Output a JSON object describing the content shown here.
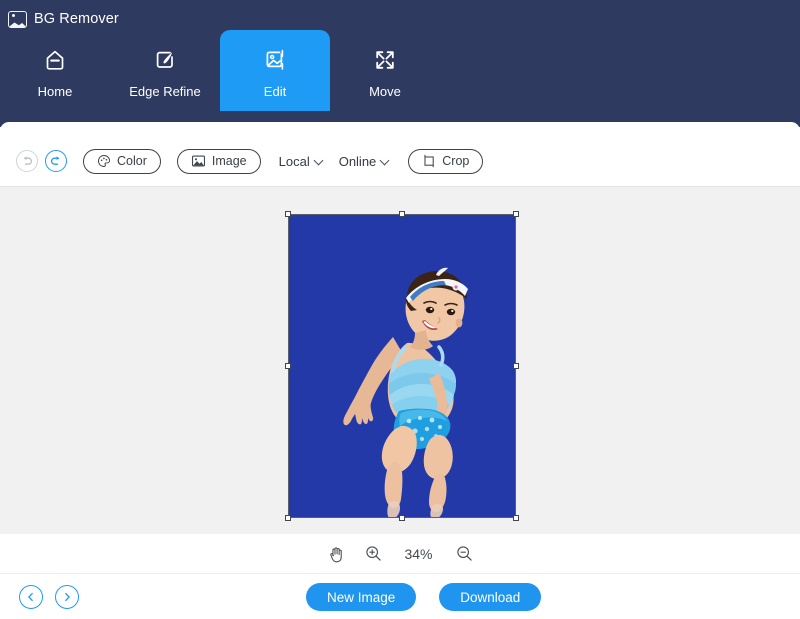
{
  "app": {
    "title": "BG Remover",
    "logo_icon": "image-photo-icon"
  },
  "nav": {
    "items": [
      {
        "label": "Home",
        "icon": "home-icon",
        "active": false
      },
      {
        "label": "Edge Refine",
        "icon": "brush-square-icon",
        "active": false
      },
      {
        "label": "Edit",
        "icon": "image-edit-icon",
        "active": true
      },
      {
        "label": "Move",
        "icon": "move-arrows-icon",
        "active": false
      }
    ]
  },
  "toolbar": {
    "undo": {
      "label": "Undo",
      "icon": "undo-arrow-icon",
      "enabled": false
    },
    "redo": {
      "label": "Redo",
      "icon": "redo-arrow-icon",
      "enabled": true
    },
    "color_button": {
      "label": "Color",
      "icon": "palette-icon"
    },
    "image_button": {
      "label": "Image",
      "icon": "picture-icon"
    },
    "local_dropdown": {
      "label": "Local",
      "icon": "chevron-down-icon"
    },
    "online_dropdown": {
      "label": "Online",
      "icon": "chevron-down-icon"
    },
    "crop_button": {
      "label": "Crop",
      "icon": "crop-square-icon"
    }
  },
  "canvas": {
    "background_color": "#f1f1f1",
    "image": {
      "background_color": "#2439a8",
      "alt": "baby girl in blue swimsuit on royal blue background",
      "selected": true,
      "handle_count": 8
    }
  },
  "zoombar": {
    "pan_icon": "hand-icon",
    "zoom_in_icon": "zoom-in-icon",
    "zoom_out_icon": "zoom-out-icon",
    "zoom_level": "34%"
  },
  "footer": {
    "prev_icon": "chevron-left-circle-icon",
    "next_icon": "chevron-right-circle-icon",
    "new_image_label": "New Image",
    "download_label": "Download"
  },
  "colors": {
    "header_navy": "#2e3a5f",
    "accent_blue": "#1e9bf5",
    "button_blue": "#1f95f0",
    "canvas_gray": "#f1f1f1",
    "image_blue": "#2439a8"
  }
}
